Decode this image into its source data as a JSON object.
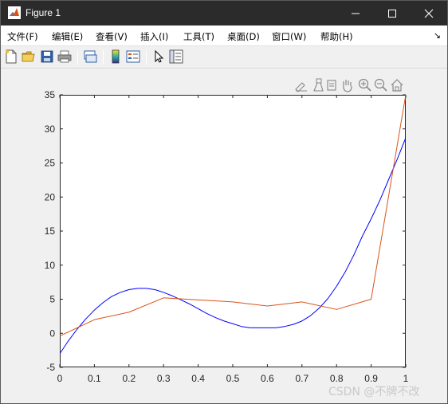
{
  "window": {
    "title": "Figure 1"
  },
  "menubar": {
    "items": [
      {
        "label": "文件(F)"
      },
      {
        "label": "编辑(E)"
      },
      {
        "label": "查看(V)"
      },
      {
        "label": "插入(I)"
      },
      {
        "label": "工具(T)"
      },
      {
        "label": "桌面(D)"
      },
      {
        "label": "窗口(W)"
      },
      {
        "label": "帮助(H)"
      }
    ],
    "overflow_icon": "chevron-arrow-icon"
  },
  "toolbar": {
    "buttons": [
      "new-figure-icon",
      "open-file-icon",
      "save-icon",
      "print-icon",
      "link-icon",
      "colorbar-icon",
      "legend-icon",
      "pointer-icon",
      "property-inspector-icon"
    ]
  },
  "axes_toolbar": {
    "buttons": [
      "brush-icon",
      "data-tips-icon",
      "rotate-icon",
      "pan-icon",
      "zoom-in-icon",
      "zoom-out-icon",
      "home-icon"
    ]
  },
  "watermark": "CSDN @不牌不改",
  "colors": {
    "series_blue": "#0000ff",
    "series_red": "#d95319"
  },
  "chart_data": {
    "type": "line",
    "xlim": [
      0,
      1
    ],
    "ylim": [
      -5,
      35
    ],
    "xticks": [
      "0",
      "0.1",
      "0.2",
      "0.3",
      "0.4",
      "0.5",
      "0.6",
      "0.7",
      "0.8",
      "0.9",
      "1"
    ],
    "yticks": [
      "-5",
      "0",
      "5",
      "10",
      "15",
      "20",
      "25",
      "30",
      "35"
    ],
    "grid": false,
    "series": [
      {
        "color": "#0000ff",
        "x": [
          0,
          0.025,
          0.05,
          0.075,
          0.1,
          0.125,
          0.15,
          0.175,
          0.2,
          0.225,
          0.25,
          0.275,
          0.3,
          0.325,
          0.35,
          0.375,
          0.4,
          0.425,
          0.45,
          0.475,
          0.5,
          0.525,
          0.55,
          0.575,
          0.6,
          0.625,
          0.65,
          0.675,
          0.7,
          0.725,
          0.75,
          0.775,
          0.8,
          0.825,
          0.85,
          0.875,
          0.9,
          0.925,
          0.95,
          0.975,
          1.0
        ],
        "y": [
          -3.0,
          -1.1,
          0.6,
          2.1,
          3.4,
          4.5,
          5.4,
          6.0,
          6.4,
          6.6,
          6.6,
          6.4,
          6.0,
          5.5,
          4.9,
          4.3,
          3.6,
          2.9,
          2.3,
          1.8,
          1.4,
          1.0,
          0.8,
          0.8,
          0.8,
          0.8,
          1.0,
          1.3,
          1.8,
          2.6,
          3.7,
          5.1,
          6.9,
          9.0,
          11.5,
          14.3,
          16.8,
          19.5,
          22.5,
          25.5,
          28.7
        ]
      },
      {
        "color": "#d95319",
        "x": [
          0,
          0.1,
          0.2,
          0.3,
          0.4,
          0.5,
          0.6,
          0.7,
          0.8,
          0.9,
          1.0
        ],
        "y": [
          -0.4,
          2.0,
          3.1,
          5.2,
          4.9,
          4.6,
          4.0,
          4.6,
          3.5,
          5.0,
          35.0
        ]
      }
    ]
  }
}
